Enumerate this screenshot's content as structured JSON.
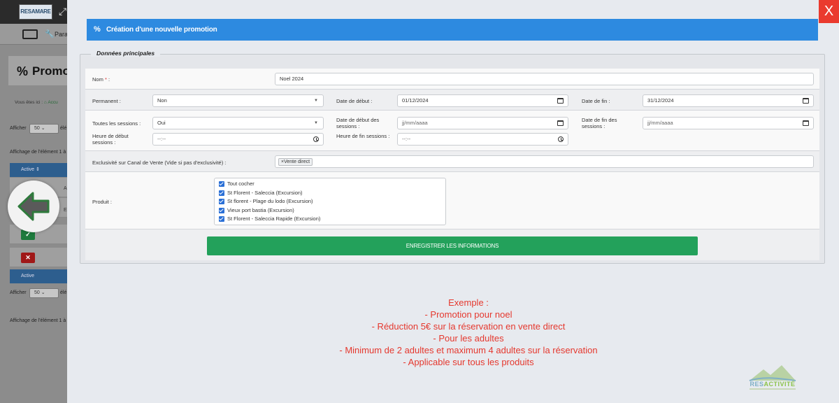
{
  "background": {
    "logo": "RESAMARE",
    "toolbar_params": "Para",
    "page_title": "Promoti",
    "breadcrumb_label": "Vous êtes ici :",
    "breadcrumb_home": "Accu",
    "show_label_1": "Afficher",
    "show_value_1": "50",
    "show_suffix_1": "élé",
    "display_info_1": "Affichage de l'élément 1 à",
    "col_active": "Active",
    "cell_a": "A",
    "cell_e": "E",
    "col_active_2": "Active",
    "show_label_2": "Afficher",
    "show_value_2": "50",
    "show_suffix_2": "élé",
    "display_info_2": "Affichage de l'élément 1 à"
  },
  "modal": {
    "close_label": "X",
    "title": "Création d'une nouvelle promotion",
    "legend": "Données principales",
    "fields": {
      "name_label": "Nom",
      "name_required_mark": "*",
      "name_colon": ":",
      "name_value": "Noel 2024",
      "permanent_label": "Permanent :",
      "permanent_value": "Non",
      "start_date_label": "Date de début :",
      "start_date_value": "01/12/2024",
      "end_date_label": "Date de fin :",
      "end_date_value": "31/12/2024",
      "all_sessions_label": "Toutes les sessions :",
      "all_sessions_value": "Oui",
      "sessions_start_date_label": "Date de début des sessions :",
      "sessions_start_date_placeholder": "jj/mm/aaaa",
      "sessions_end_date_label": "Date de fin des sessions :",
      "sessions_end_date_placeholder": "jj/mm/aaaa",
      "sessions_start_time_label": "Heure de début sessions :",
      "sessions_start_time_placeholder": "--:--",
      "sessions_end_time_label": "Heure de fin sessions :",
      "sessions_end_time_placeholder": "--:--",
      "channel_label": "Exclusivité sur Canal de Vente (Vide si pas d'exclusivité) :",
      "channel_tag": "×Vente direct",
      "product_label": "Produit :"
    },
    "products": [
      {
        "label": "Tout cocher",
        "checked": true
      },
      {
        "label": "St Florent - Saleccia (Excursion)",
        "checked": true
      },
      {
        "label": "St florent - Plage du lodo (Excursion)",
        "checked": true
      },
      {
        "label": "Vieux port bastia (Excursion)",
        "checked": true
      },
      {
        "label": "St Florent - Saleccia Rapide (Excursion)",
        "checked": true
      }
    ],
    "save_label": "ENREGISTRER LES INFORMATIONS"
  },
  "example": {
    "lines": [
      "Exemple :",
      "- Promotion pour noel",
      "- Réduction 5€ sur la réservation en vente direct",
      "- Pour les adultes",
      "- Minimum de 2 adultes et maximum 4 adultes sur la réservation",
      "- Applicable sur tous les produits"
    ]
  },
  "brand": {
    "name_part1": "RES",
    "name_part2": "ACTIVITÉ"
  },
  "colors": {
    "header_blue": "#2d8ae0",
    "save_green": "#23a15b",
    "close_red": "#ea3a2e",
    "example_red": "#e5382e",
    "checkbox_blue": "#2a6fd6"
  }
}
